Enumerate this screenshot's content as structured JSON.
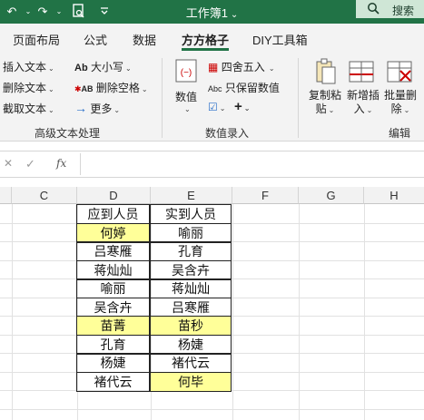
{
  "titlebar": {
    "title": "工作簿1",
    "caret": "⌄",
    "search_label": "搜索",
    "icons": [
      "undo-icon",
      "redo-icon",
      "print-preview-icon",
      "customize-qat-icon",
      "search-icon"
    ]
  },
  "tabs": [
    "页面布局",
    "公式",
    "数据",
    "方方格子",
    "DIY工具箱"
  ],
  "active_tab": "方方格子",
  "ribbon": {
    "text_group": {
      "insert_text": "插入文本",
      "delete_text": "删除文本",
      "cut_text": "截取文本",
      "case_icon_label": "Ab",
      "case": "大小写",
      "trim_icon_label": "AB",
      "trim": "删除空格",
      "more": "更多",
      "label": "高级文本处理"
    },
    "numeric_group": {
      "numeric": "数值",
      "round": "四舍五入",
      "keep_icon_label": "Abc",
      "keep_value": "只保留数值",
      "plus": "+",
      "label": "数值录入"
    },
    "edit_group": {
      "copy_paste": "复制粘贴",
      "new_insert": "新增插入",
      "batch_delete": "批量删除",
      "label": "编辑"
    }
  },
  "formula_bar": {
    "cancel": "✕",
    "confirm": "✓",
    "fx": "fx",
    "value": ""
  },
  "columns": [
    "C",
    "D",
    "E",
    "F",
    "G",
    "H"
  ],
  "table": {
    "header": [
      "应到人员",
      "实到人员"
    ],
    "rows": [
      [
        "何婷",
        "喻丽"
      ],
      [
        "吕寒雁",
        "孔育"
      ],
      [
        "蒋灿灿",
        "吴含卉"
      ],
      [
        "喻丽",
        "蒋灿灿"
      ],
      [
        "吴含卉",
        "吕寒雁"
      ],
      [
        "苗菁",
        "苗秒"
      ],
      [
        "孔育",
        "杨婕"
      ],
      [
        "杨婕",
        "褚代云"
      ],
      [
        "褚代云",
        "何毕"
      ]
    ],
    "highlight_color": "#ffff99"
  },
  "colors": {
    "brand": "#217346",
    "ribbon_bg": "#f3f3f3"
  }
}
